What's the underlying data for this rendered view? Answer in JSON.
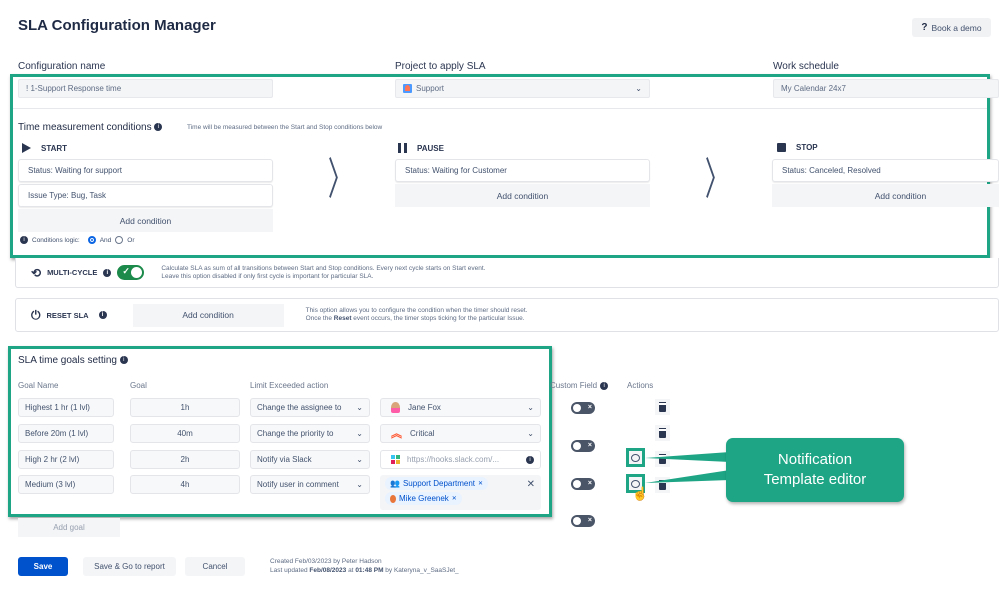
{
  "header": {
    "title": "SLA Configuration Manager",
    "demo_icon": "question-icon",
    "demo_label": "Book a demo"
  },
  "config": {
    "name_label": "Configuration name",
    "name_value": "! 1-Support Response time",
    "project_label": "Project to apply SLA",
    "project_value": "Support",
    "project_icon": "project-avatar-icon",
    "schedule_label": "Work schedule",
    "schedule_value": "My Calendar 24x7"
  },
  "time_measurement": {
    "title": "Time measurement conditions",
    "hint": "Time will be measured between the Start and Stop conditions below",
    "start": {
      "label": "START",
      "icon": "play-icon",
      "conditions": [
        "Status: Waiting for support",
        "Issue Type: Bug, Task"
      ],
      "add_label": "Add condition"
    },
    "pause": {
      "label": "PAUSE",
      "icon": "pause-icon",
      "conditions": [
        "Status: Waiting for Customer"
      ],
      "add_label": "Add condition"
    },
    "stop": {
      "label": "STOP",
      "icon": "stop-icon",
      "conditions": [
        "Status: Canceled, Resolved"
      ],
      "add_label": "Add condition"
    },
    "logic_label": "Conditions logic:",
    "logic_options": [
      "And",
      "Or"
    ],
    "logic_selected": "And"
  },
  "multi_cycle": {
    "icon": "history-icon",
    "label": "MULTI-CYCLE",
    "enabled": true,
    "desc_line1": "Calculate SLA as sum of all transitions between Start and Stop conditions. Every next cycle starts on Start event.",
    "desc_line2": "Leave this option disabled if only first cycle is important for particular SLA."
  },
  "reset_sla": {
    "icon": "power-icon",
    "label": "RESET SLA",
    "add_label": "Add condition",
    "desc_line1": "This option allows you to configure the condition when the timer should reset.",
    "desc_line2_pre": "Once the ",
    "desc_line2_bold": "Reset",
    "desc_line2_post": " event occurs, the timer stops ticking for the particular Issue."
  },
  "goals": {
    "title": "SLA time goals setting",
    "headers": {
      "goal_name": "Goal Name",
      "goal": "Goal",
      "action": "Limit Exceeded action",
      "custom_field": "Custom Field",
      "actions": "Actions"
    },
    "rows": [
      {
        "name": "Highest 1 hr (1 lvl)",
        "goal": "1h",
        "action": "Change the assignee to",
        "target": "Jane Fox",
        "target_icon": "user-avatar-icon",
        "custom_field_on": false,
        "has_notification": false
      },
      {
        "name": "Before 20m (1 lvl)",
        "goal": "40m",
        "action": "Change the priority to",
        "target": "Critical",
        "target_icon": "priority-critical-icon",
        "custom_field_on": false,
        "has_notification": false
      },
      {
        "name": "High 2 hr (2 lvl)",
        "goal": "2h",
        "action": "Notify via Slack",
        "target": "https://hooks.slack.com/...",
        "target_icon": "slack-icon",
        "custom_field_on": false,
        "has_notification": true
      },
      {
        "name": "Medium (3 lvl)",
        "goal": "4h",
        "action": "Notify user in comment",
        "tags": [
          "Support Department",
          "Mike Greenek"
        ],
        "custom_field_on": false,
        "has_notification": true
      }
    ],
    "add_label": "Add goal"
  },
  "callout": {
    "line1": "Notification",
    "line2": "Template editor",
    "color": "#1ea585"
  },
  "footer": {
    "save": "Save",
    "save_report": "Save & Go to report",
    "cancel": "Cancel",
    "created": "Created Feb/03/2023 by Peter Hadson",
    "updated_pre": "Last updated ",
    "updated_date": "Feb/08/2023",
    "updated_mid": " at ",
    "updated_time": "01:48 PM",
    "updated_post": " by Kateryna_v_SaaSJet_"
  },
  "colors": {
    "accent_green": "#1ea585",
    "primary_blue": "#0052cc",
    "toggle_on": "#1b8a4a"
  }
}
